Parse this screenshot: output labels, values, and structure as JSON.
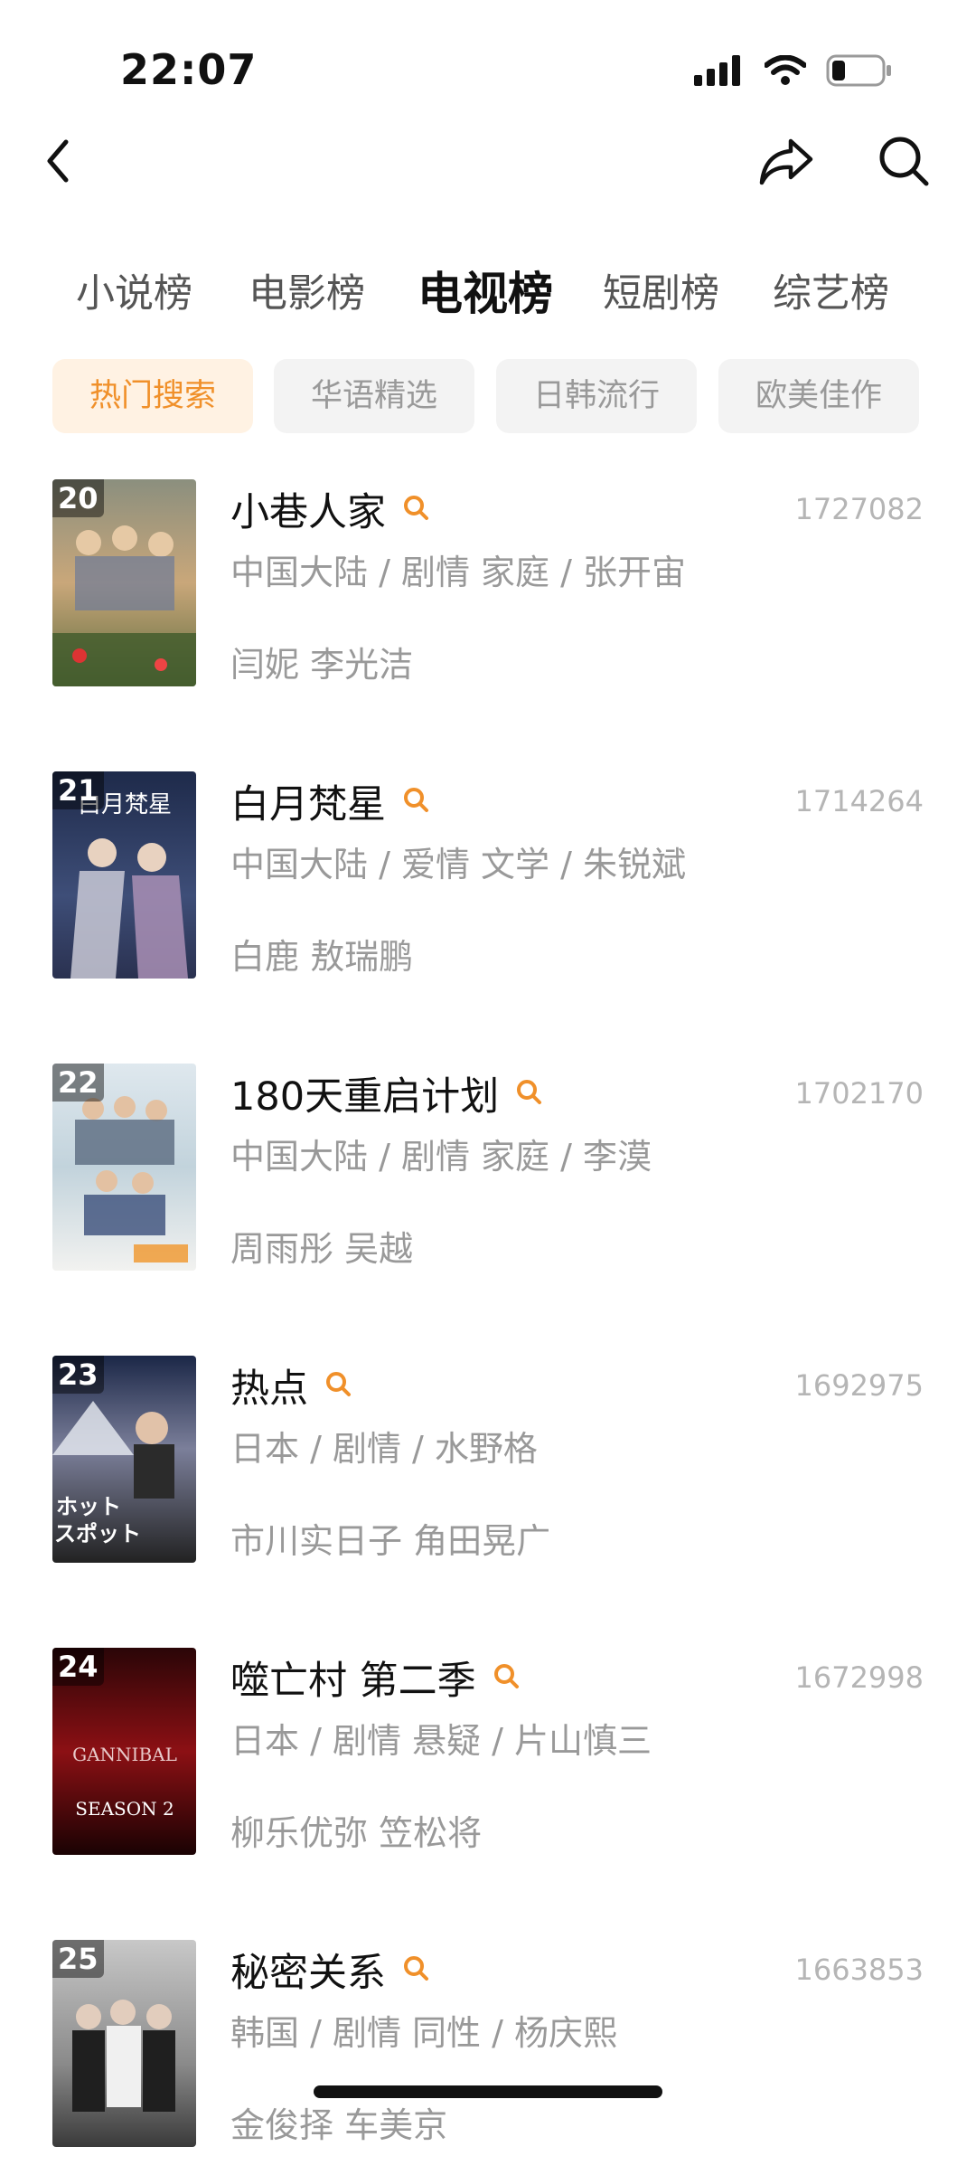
{
  "status_bar": {
    "time": "22:07"
  },
  "nav": {
    "icons": [
      "back-arrow-icon",
      "share-icon",
      "search-icon"
    ]
  },
  "tabs": [
    {
      "label": "小说榜",
      "active": false
    },
    {
      "label": "电影榜",
      "active": false
    },
    {
      "label": "电视榜",
      "active": true
    },
    {
      "label": "短剧榜",
      "active": false
    },
    {
      "label": "综艺榜",
      "active": false
    }
  ],
  "chips": [
    {
      "label": "热门搜索",
      "active": true
    },
    {
      "label": "华语精选",
      "active": false
    },
    {
      "label": "日韩流行",
      "active": false
    },
    {
      "label": "欧美佳作",
      "active": false
    }
  ],
  "colors": {
    "accent": "#f0902a",
    "chip_active_bg": "#fff2e3",
    "chip_bg": "#f3f3f3",
    "muted_text": "#999999"
  },
  "items": [
    {
      "rank": "20",
      "title": "小巷人家",
      "count": "1727082",
      "meta": "中国大陆 / 剧情 家庭 / 张开宙",
      "cast": "闫妮 李光洁"
    },
    {
      "rank": "21",
      "title": "白月梵星",
      "count": "1714264",
      "meta": "中国大陆 / 爱情 文学 / 朱锐斌",
      "cast": "白鹿 敖瑞鹏"
    },
    {
      "rank": "22",
      "title": "180天重启计划",
      "count": "1702170",
      "meta": "中国大陆 / 剧情 家庭 / 李漠",
      "cast": "周雨彤 吴越"
    },
    {
      "rank": "23",
      "title": "热点",
      "count": "1692975",
      "meta": "日本 / 剧情 / 水野格",
      "cast": "市川实日子 角田晃广"
    },
    {
      "rank": "24",
      "title": "噬亡村 第二季",
      "count": "1672998",
      "meta": "日本 / 剧情 悬疑 / 片山慎三",
      "cast": "柳乐优弥 笠松将"
    },
    {
      "rank": "25",
      "title": "秘密关系",
      "count": "1663853",
      "meta": "韩国 / 剧情 同性 / 杨庆熙",
      "cast": "金俊择 车美京"
    }
  ]
}
